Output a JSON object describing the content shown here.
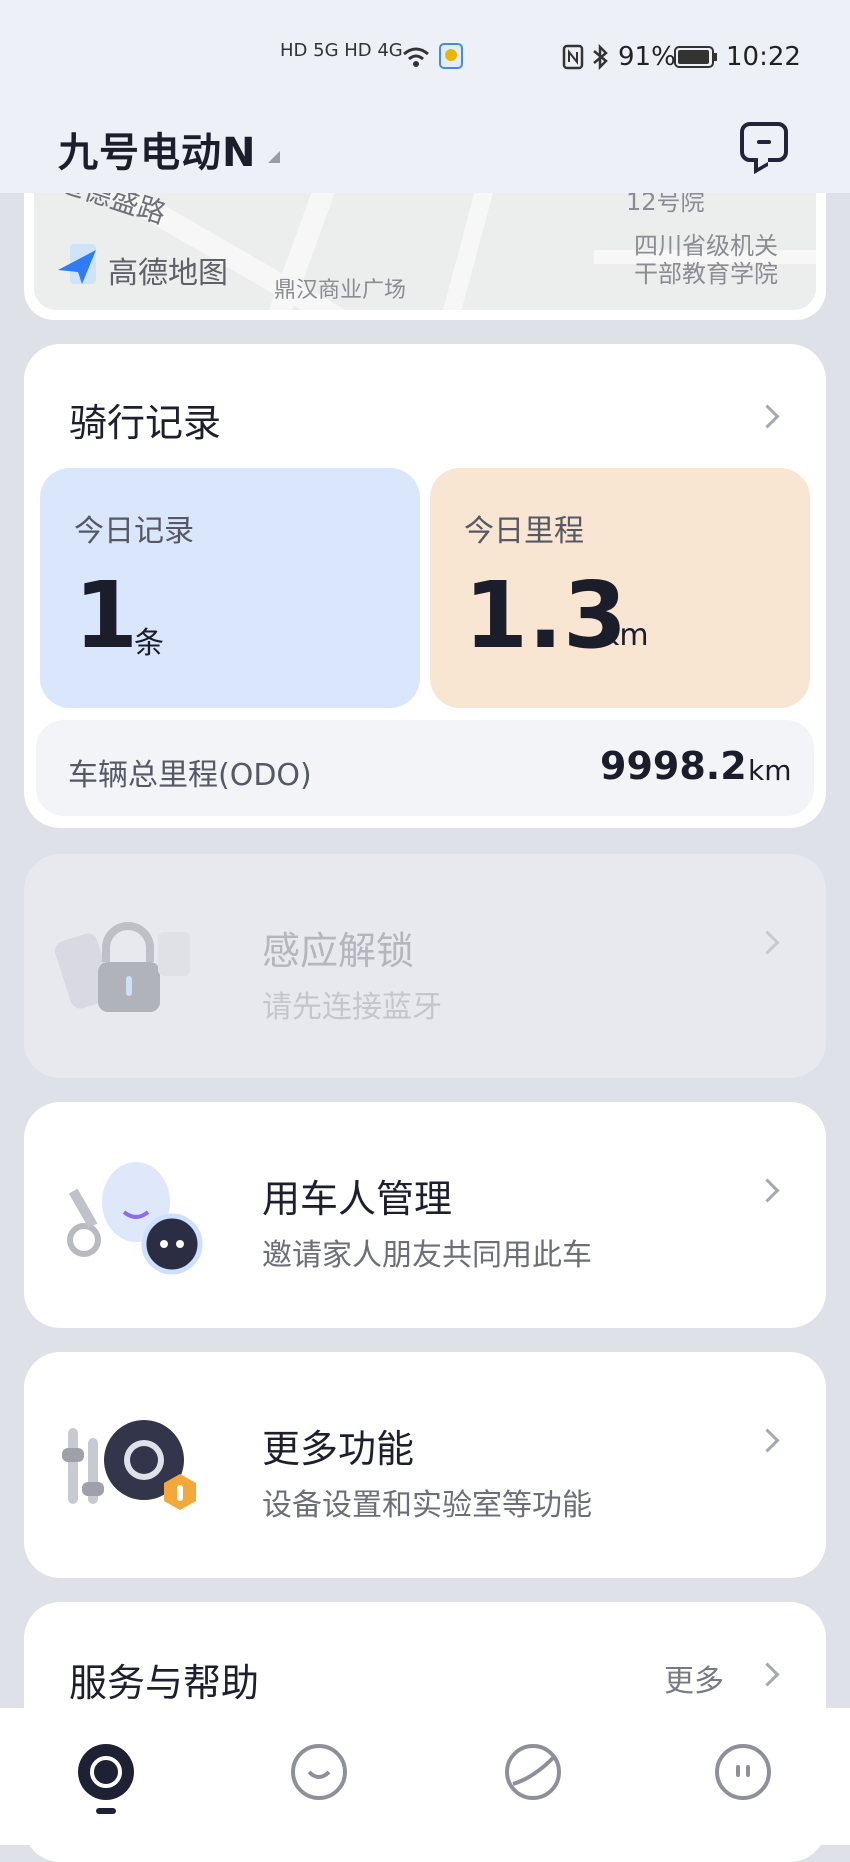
{
  "status_bar": {
    "network_left": "HD 5G  HD 4G",
    "battery": "91%",
    "time": "10:22"
  },
  "header": {
    "title": "九号电动N",
    "message_icon": "message-icon"
  },
  "map": {
    "labels": [
      "道德盛路",
      "12号院",
      "四川省级机关",
      "干部教育学院",
      "鼎汉商业广场"
    ],
    "provider": "高德地图"
  },
  "ride_record": {
    "title": "骑行记录",
    "today_records": {
      "label": "今日记录",
      "value": "1",
      "unit": "条"
    },
    "today_mileage": {
      "label": "今日里程",
      "value": "1.3",
      "unit": "km"
    },
    "odo": {
      "label": "车辆总里程(ODO)",
      "value": "9998.2",
      "unit": "km"
    }
  },
  "features": [
    {
      "title": "感应解锁",
      "subtitle": "请先连接蓝牙",
      "icon": "lock-icon",
      "enabled": false
    },
    {
      "title": "用车人管理",
      "subtitle": "邀请家人朋友共同用此车",
      "icon": "user-key-icon",
      "enabled": true
    },
    {
      "title": "更多功能",
      "subtitle": "设备设置和实验室等功能",
      "icon": "settings-icon",
      "enabled": true
    }
  ],
  "service": {
    "title": "服务与帮助",
    "more": "更多"
  },
  "bottom_nav": [
    "home-icon",
    "chat-icon",
    "discover-icon",
    "profile-icon"
  ],
  "colors": {
    "accent": "#1d1e2c",
    "blue_tile": "#d9e6fb",
    "orange_tile": "#f8e6d2"
  }
}
